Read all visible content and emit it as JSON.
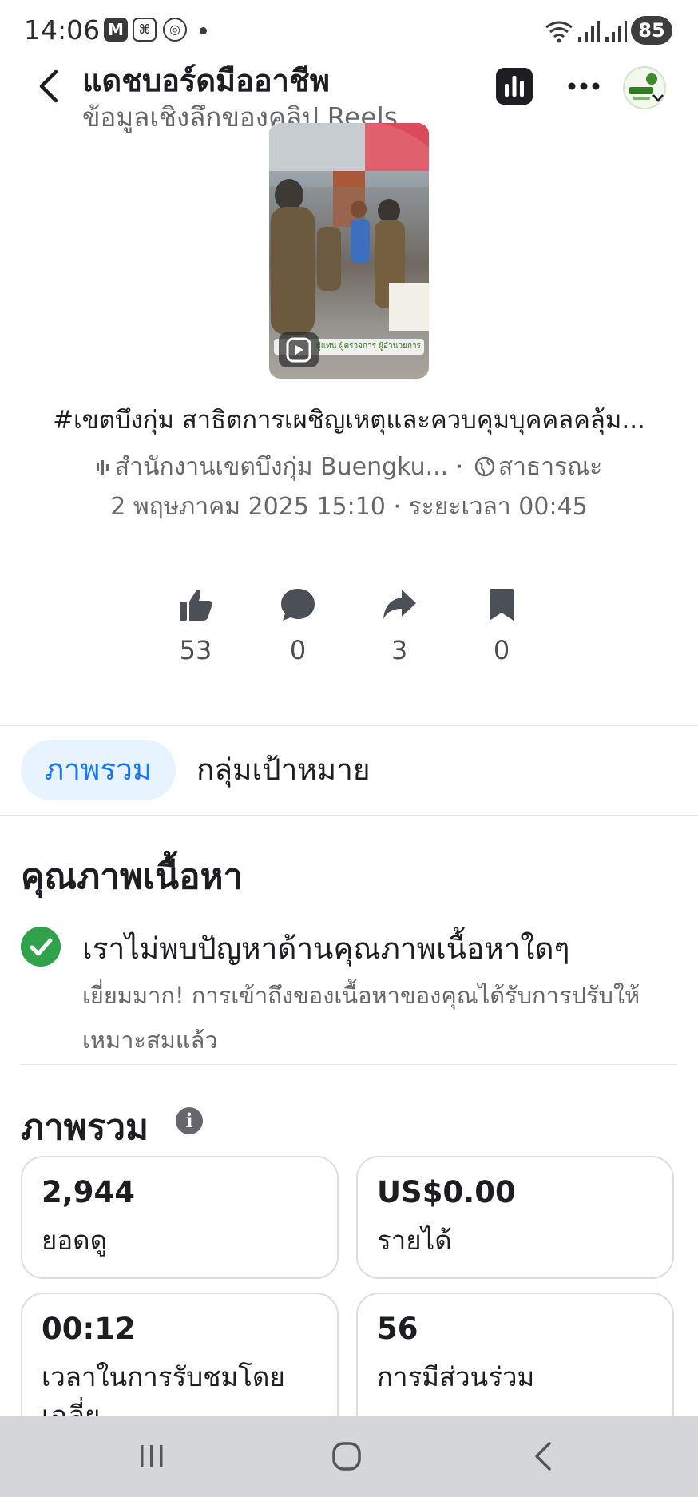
{
  "status_bar": {
    "time": "14:06",
    "notif_icons": [
      "M",
      "⌘",
      "◎"
    ],
    "battery": "85"
  },
  "header": {
    "title": "แดชบอร์ดมืออาชีพ",
    "subtitle": "ข้อมูลเชิงลึกของคลิป Reels"
  },
  "video": {
    "thumbnail_text": "ผู้แทน ผู้ตรวจการ ผู้อำนวยการ",
    "caption": "#เขตบึงกุ่ม สาธิตการเผชิญเหตุและควบคุมบุคคลคลุ้ม...",
    "page_name": "สำนักงานเขตบึงกุ่ม Buengku...",
    "separator": "·",
    "audience": "สาธารณะ",
    "date": "2 พฤษภาคม  2025 15:10",
    "duration": "· ระยะเวลา 00:45"
  },
  "stats": {
    "likes": "53",
    "comments": "0",
    "shares": "3",
    "saves": "0"
  },
  "tabs": {
    "overview": "ภาพรวม",
    "audience": "กลุ่มเป้าหมาย"
  },
  "quality": {
    "heading": "คุณภาพเนื้อหา",
    "title": "เราไม่พบปัญหาด้านคุณภาพเนื้อหาใดๆ",
    "description": "เยี่ยมมาก! การเข้าถึงของเนื้อหาของคุณได้รับการปรับให้เหมาะสมแล้ว"
  },
  "overview": {
    "heading": "ภาพรวม",
    "info_icon": "i",
    "cards": [
      {
        "value": "2,944",
        "label": "ยอดดู"
      },
      {
        "value": "US$0.00",
        "label": "รายได้"
      },
      {
        "value": "00:12",
        "label": "เวลาในการรับชมโดยเฉลี่ย"
      },
      {
        "value": "56",
        "label": "การมีส่วนร่วม"
      }
    ]
  },
  "colors": {
    "accent": "#1877f2",
    "success": "#31a24c",
    "muted": "#65676b"
  }
}
